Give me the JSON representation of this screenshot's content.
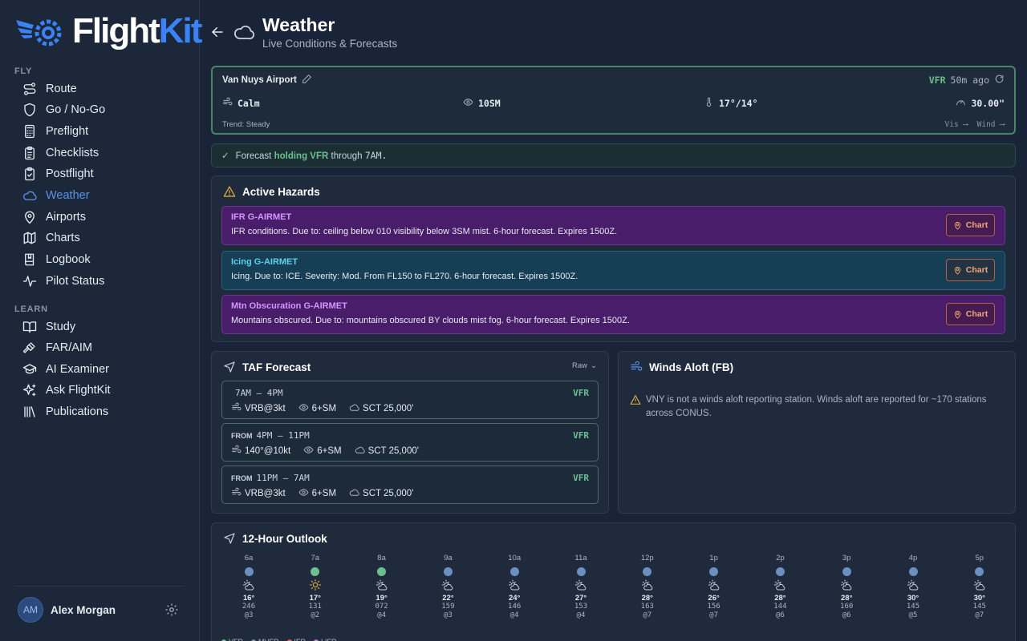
{
  "app": {
    "name_part1": "Flight",
    "name_part2": "Kit"
  },
  "sidebar": {
    "section_fly": "FLY",
    "section_learn": "LEARN",
    "fly_items": [
      {
        "label": "Route",
        "icon": "route-icon"
      },
      {
        "label": "Go / No-Go",
        "icon": "shield-icon"
      },
      {
        "label": "Preflight",
        "icon": "calculator-icon"
      },
      {
        "label": "Checklists",
        "icon": "clipboard-list-icon"
      },
      {
        "label": "Postflight",
        "icon": "clipboard-check-icon"
      },
      {
        "label": "Weather",
        "icon": "cloud-icon",
        "active": true
      },
      {
        "label": "Airports",
        "icon": "map-pin-icon"
      },
      {
        "label": "Charts",
        "icon": "map-icon"
      },
      {
        "label": "Logbook",
        "icon": "book-icon"
      },
      {
        "label": "Pilot Status",
        "icon": "activity-icon"
      }
    ],
    "learn_items": [
      {
        "label": "Study",
        "icon": "open-book-icon"
      },
      {
        "label": "FAR/AIM",
        "icon": "gavel-icon"
      },
      {
        "label": "AI Examiner",
        "icon": "graduation-cap-icon"
      },
      {
        "label": "Ask FlightKit",
        "icon": "sparkles-icon"
      },
      {
        "label": "Publications",
        "icon": "library-icon"
      }
    ],
    "user": {
      "initials": "AM",
      "name": "Alex Morgan"
    }
  },
  "header": {
    "title": "Weather",
    "subtitle": "Live Conditions & Forecasts"
  },
  "metar": {
    "station": "Van Nuys Airport",
    "category": "VFR",
    "age": "50m ago",
    "wind": "Calm",
    "visibility": "10SM",
    "temp_dew": "17°/14°",
    "altimeter": "30.00\"",
    "trend": "Trend: Steady",
    "trend_vis": "Vis",
    "trend_wind": "Wind"
  },
  "forecast_banner": {
    "prefix": "Forecast",
    "bold": "holding VFR",
    "suffix": "through",
    "time": "7AM."
  },
  "hazards": {
    "title": "Active Hazards",
    "chart_label": "Chart",
    "items": [
      {
        "title": "IFR G-AIRMET",
        "desc": "IFR conditions. Due to: ceiling below 010 visibility below 3SM mist. 6-hour forecast. Expires 1500Z.",
        "style": "purple"
      },
      {
        "title": "Icing G-AIRMET",
        "desc": "Icing. Due to: ICE. Severity: Mod. From FL150 to FL270. 6-hour forecast. Expires 1500Z.",
        "style": "teal"
      },
      {
        "title": "Mtn Obscuration G-AIRMET",
        "desc": "Mountains obscured. Due to: mountains obscured BY clouds mist fog. 6-hour forecast. Expires 1500Z.",
        "style": "purple"
      }
    ]
  },
  "taf": {
    "title": "TAF Forecast",
    "raw_label": "Raw",
    "periods": [
      {
        "from": "",
        "range": "7AM – 4PM",
        "cat": "VFR",
        "wind": "VRB@3kt",
        "vis": "6+SM",
        "sky": "SCT 25,000'"
      },
      {
        "from": "FROM",
        "range": "4PM – 11PM",
        "cat": "VFR",
        "wind": "140°@10kt",
        "vis": "6+SM",
        "sky": "SCT 25,000'"
      },
      {
        "from": "FROM",
        "range": "11PM – 7AM",
        "cat": "VFR",
        "wind": "VRB@3kt",
        "vis": "6+SM",
        "sky": "SCT 25,000'"
      }
    ]
  },
  "winds": {
    "title": "Winds Aloft (FB)",
    "message": "VNY is not a winds aloft reporting station. Winds aloft are reported for ~170 stations across CONUS."
  },
  "outlook": {
    "title": "12-Hour Outlook",
    "hours": [
      {
        "label": "6a",
        "cat": "mvfr",
        "wx": "partly-cloudy",
        "temp": "16°",
        "dir": "246",
        "spd": "@3"
      },
      {
        "label": "7a",
        "cat": "vfr",
        "wx": "sunny",
        "temp": "17°",
        "dir": "131",
        "spd": "@2"
      },
      {
        "label": "8a",
        "cat": "vfr",
        "wx": "partly-cloudy",
        "temp": "19°",
        "dir": "072",
        "spd": "@4"
      },
      {
        "label": "9a",
        "cat": "mvfr",
        "wx": "partly-cloudy",
        "temp": "22°",
        "dir": "159",
        "spd": "@3"
      },
      {
        "label": "10a",
        "cat": "mvfr",
        "wx": "partly-cloudy",
        "temp": "24°",
        "dir": "146",
        "spd": "@4"
      },
      {
        "label": "11a",
        "cat": "mvfr",
        "wx": "partly-cloudy",
        "temp": "27°",
        "dir": "153",
        "spd": "@4"
      },
      {
        "label": "12p",
        "cat": "mvfr",
        "wx": "partly-cloudy",
        "temp": "28°",
        "dir": "163",
        "spd": "@7"
      },
      {
        "label": "1p",
        "cat": "mvfr",
        "wx": "partly-cloudy",
        "temp": "26°",
        "dir": "156",
        "spd": "@7"
      },
      {
        "label": "2p",
        "cat": "mvfr",
        "wx": "partly-cloudy",
        "temp": "28°",
        "dir": "144",
        "spd": "@6"
      },
      {
        "label": "3p",
        "cat": "mvfr",
        "wx": "partly-cloudy",
        "temp": "28°",
        "dir": "160",
        "spd": "@6"
      },
      {
        "label": "4p",
        "cat": "mvfr",
        "wx": "partly-cloudy",
        "temp": "30°",
        "dir": "145",
        "spd": "@5"
      },
      {
        "label": "5p",
        "cat": "mvfr",
        "wx": "partly-cloudy",
        "temp": "30°",
        "dir": "145",
        "spd": "@7"
      }
    ],
    "legend": [
      {
        "label": "VFR",
        "color": "#6cc08e"
      },
      {
        "label": "MVFR",
        "color": "#6b8fc0"
      },
      {
        "label": "IFR",
        "color": "#e06060"
      },
      {
        "label": "LIFR",
        "color": "#c27ad8"
      }
    ]
  },
  "colors": {
    "vfr": "#6cc08e",
    "mvfr": "#6b8fc0",
    "accent": "#3b82f6"
  }
}
